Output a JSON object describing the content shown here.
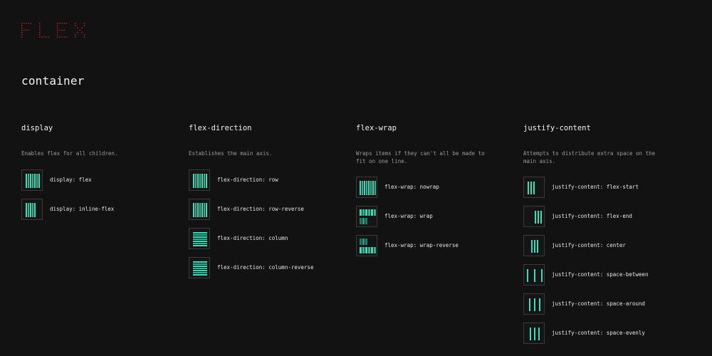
{
  "brand": {
    "logo_text": "FLEX",
    "logo_color": "#c0222a"
  },
  "section": {
    "title": "container"
  },
  "accent": "#2fe0b8",
  "columns": [
    {
      "title": "display",
      "description": "Enables flex for all children.",
      "items": [
        {
          "label": "display: flex",
          "icon": "display-flex-icon"
        },
        {
          "label": "display: inline-flex",
          "icon": "display-inline-flex-icon"
        }
      ]
    },
    {
      "title": "flex-direction",
      "description": "Establishes the main axis.",
      "items": [
        {
          "label": "flex-direction: row",
          "icon": "flex-direction-row-icon"
        },
        {
          "label": "flex-direction: row-reverse",
          "icon": "flex-direction-row-reverse-icon"
        },
        {
          "label": "flex-direction: column",
          "icon": "flex-direction-column-icon"
        },
        {
          "label": "flex-direction: column-reverse",
          "icon": "flex-direction-column-reverse-icon"
        }
      ]
    },
    {
      "title": "flex-wrap",
      "description": "Wraps items if they can't all be made to fit on one line.",
      "items": [
        {
          "label": "flex-wrap: nowrap",
          "icon": "flex-wrap-nowrap-icon"
        },
        {
          "label": "flex-wrap: wrap",
          "icon": "flex-wrap-wrap-icon"
        },
        {
          "label": "flex-wrap: wrap-reverse",
          "icon": "flex-wrap-wrap-reverse-icon"
        }
      ]
    },
    {
      "title": "justify-content",
      "description": "Attempts to distribute extra space on the main axis.",
      "items": [
        {
          "label": "justify-content: flex-start",
          "icon": "justify-flex-start-icon"
        },
        {
          "label": "justify-content: flex-end",
          "icon": "justify-flex-end-icon"
        },
        {
          "label": "justify-content: center",
          "icon": "justify-center-icon"
        },
        {
          "label": "justify-content: space-between",
          "icon": "justify-space-between-icon"
        },
        {
          "label": "justify-content: space-around",
          "icon": "justify-space-around-icon"
        },
        {
          "label": "justify-content: space-evenly",
          "icon": "justify-space-evenly-icon"
        }
      ]
    }
  ]
}
